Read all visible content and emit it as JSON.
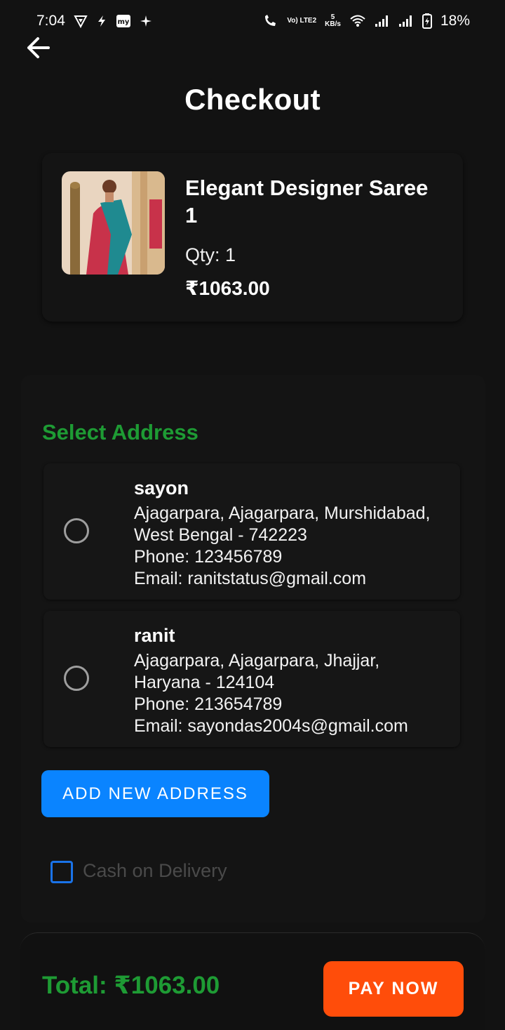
{
  "status_bar": {
    "time": "7:04",
    "lte_label": "Vo) LTE2",
    "speed_value": "5",
    "speed_unit": "KB/s",
    "battery": "18%"
  },
  "header": {
    "title": "Checkout",
    "back_icon": "arrow-left-icon"
  },
  "product": {
    "name": "Elegant Designer Saree 1",
    "qty": "Qty: 1",
    "price": "₹1063.00"
  },
  "address_section": {
    "title": "Select Address",
    "addresses": [
      {
        "name": "sayon",
        "line1": "Ajagarpara, Ajagarpara, Murshidabad,",
        "line2": "West Bengal - 742223",
        "phone": "Phone: 123456789",
        "email": "Email: ranitstatus@gmail.com",
        "selected": false
      },
      {
        "name": "ranit",
        "line1": "Ajagarpara, Ajagarpara, Jhajjar,",
        "line2": "Haryana - 124104",
        "phone": "Phone: 213654789",
        "email": "Email: sayondas2004s@gmail.com",
        "selected": false
      }
    ],
    "add_button": "ADD NEW ADDRESS",
    "cod_label": "Cash on Delivery",
    "cod_checked": false
  },
  "footer": {
    "total": "Total: ₹1063.00",
    "pay_button": "PAY NOW"
  },
  "colors": {
    "accent_green": "#1e9b34",
    "primary_blue": "#0a84ff",
    "pay_orange": "#ff4d0a",
    "background": "#121212"
  }
}
